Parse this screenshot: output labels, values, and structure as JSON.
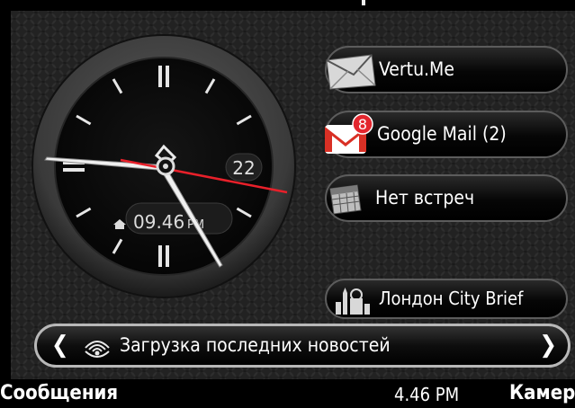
{
  "clock": {
    "date": "22",
    "alarm_time": "09.46",
    "alarm_period": "PM",
    "icons": {
      "alarm": "home-icon"
    }
  },
  "shortcuts": [
    {
      "label": "Vertu.Me",
      "icon": "envelope-icon"
    },
    {
      "label": "Google Mail (2)",
      "icon": "gmail-icon",
      "badge": "8"
    },
    {
      "label": "Нет встреч",
      "icon": "calendar-icon"
    },
    {
      "label": "Лондон City Brief",
      "icon": "london-icon"
    }
  ],
  "news_bar": {
    "text": "Загрузка последних новостей",
    "prev": "❮",
    "next": "❯",
    "icon": "signal-icon"
  },
  "softkeys": {
    "left": "Сообщения",
    "time": "4.46 PM",
    "right": "Камер"
  },
  "colors": {
    "second_hand": "#e8202a",
    "gmail_red": "#d93025",
    "badge_red": "#e3262e"
  }
}
